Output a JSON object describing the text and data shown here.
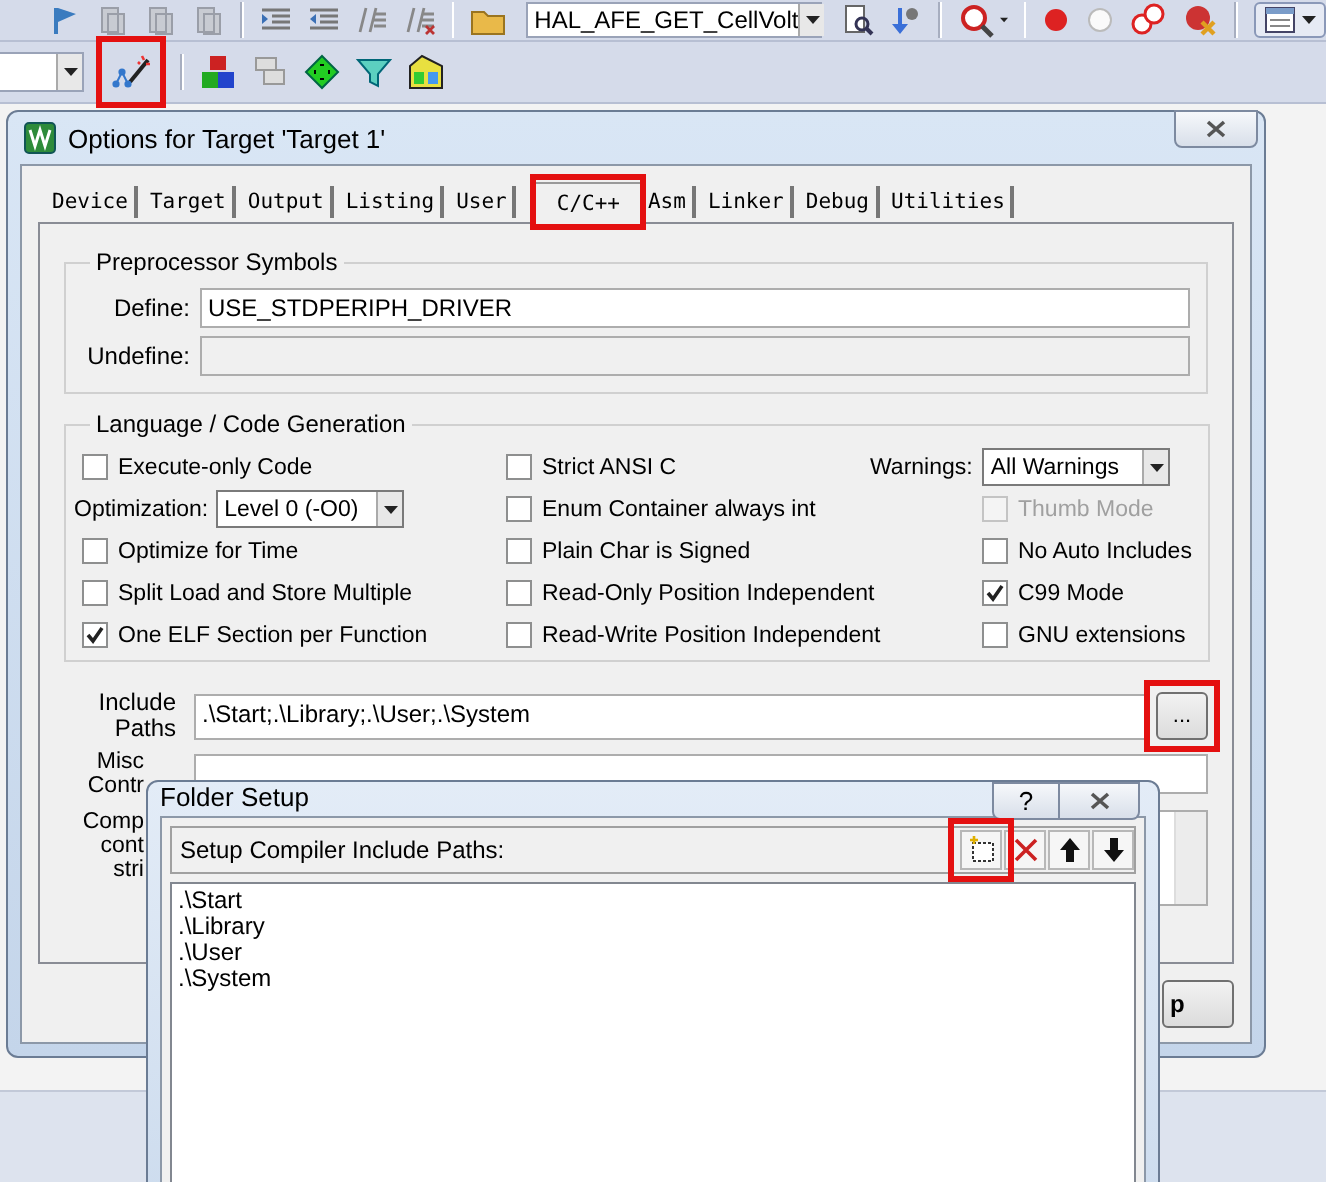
{
  "toolbar": {
    "function_combo": "HAL_AFE_GET_CellVolt",
    "options_tool_highlighted": true
  },
  "options_dialog": {
    "title": "Options for Target 'Target 1'",
    "tabs": [
      {
        "label": "Device",
        "selected": false,
        "highlighted": false
      },
      {
        "label": "Target",
        "selected": false,
        "highlighted": false
      },
      {
        "label": "Output",
        "selected": false,
        "highlighted": false
      },
      {
        "label": "Listing",
        "selected": false,
        "highlighted": false
      },
      {
        "label": "User",
        "selected": false,
        "highlighted": false
      },
      {
        "label": "C/C++",
        "selected": true,
        "highlighted": true
      },
      {
        "label": "Asm",
        "selected": false,
        "highlighted": false
      },
      {
        "label": "Linker",
        "selected": false,
        "highlighted": false
      },
      {
        "label": "Debug",
        "selected": false,
        "highlighted": false
      },
      {
        "label": "Utilities",
        "selected": false,
        "highlighted": false
      }
    ],
    "preprocessor": {
      "title": "Preprocessor Symbols",
      "define_label": "Define:",
      "define_value": "USE_STDPERIPH_DRIVER",
      "undefine_label": "Undefine:"
    },
    "language": {
      "title": "Language / Code Generation",
      "columns": [
        [
          {
            "kind": "checkbox",
            "label": "Execute-only Code",
            "checked": false,
            "disabled": false
          },
          {
            "kind": "select",
            "label": "Optimization:",
            "value": "Level 0 (-O0)"
          },
          {
            "kind": "checkbox",
            "label": "Optimize for Time",
            "checked": false,
            "disabled": false
          },
          {
            "kind": "checkbox",
            "label": "Split Load and Store Multiple",
            "checked": false,
            "disabled": false
          },
          {
            "kind": "checkbox",
            "label": "One ELF Section per Function",
            "checked": true,
            "disabled": false
          }
        ],
        [
          {
            "kind": "checkbox",
            "label": "Strict ANSI C",
            "checked": false,
            "disabled": false
          },
          {
            "kind": "checkbox",
            "label": "Enum Container always int",
            "checked": false,
            "disabled": false
          },
          {
            "kind": "checkbox",
            "label": "Plain Char is Signed",
            "checked": false,
            "disabled": false
          },
          {
            "kind": "checkbox",
            "label": "Read-Only Position Independent",
            "checked": false,
            "disabled": false
          },
          {
            "kind": "checkbox",
            "label": "Read-Write Position Independent",
            "checked": false,
            "disabled": false
          }
        ],
        [
          {
            "kind": "select",
            "label": "Warnings:",
            "value": "All Warnings"
          },
          {
            "kind": "checkbox",
            "label": "Thumb Mode",
            "checked": false,
            "disabled": true
          },
          {
            "kind": "checkbox",
            "label": "No Auto Includes",
            "checked": false,
            "disabled": false
          },
          {
            "kind": "checkbox",
            "label": "C99 Mode",
            "checked": true,
            "disabled": false
          },
          {
            "kind": "checkbox",
            "label": "GNU extensions",
            "checked": false,
            "disabled": false
          }
        ]
      ]
    },
    "include_paths": {
      "label_lines": [
        "Include",
        "Paths"
      ],
      "value": ".\\Start;.\\Library;.\\User;.\\System",
      "browse": "...",
      "browse_highlighted": true
    },
    "misc_label_lines": [
      "Misc",
      "Contr"
    ],
    "compiler_label_lines": [
      "Comp",
      "cont",
      "stri"
    ],
    "button": "p"
  },
  "folder_dialog": {
    "title": "Folder Setup",
    "help": "?",
    "list_title": "Setup Compiler Include Paths:",
    "new_highlighted": true,
    "paths": [
      ".\\Start",
      ".\\Library",
      ".\\User",
      ".\\System"
    ]
  }
}
